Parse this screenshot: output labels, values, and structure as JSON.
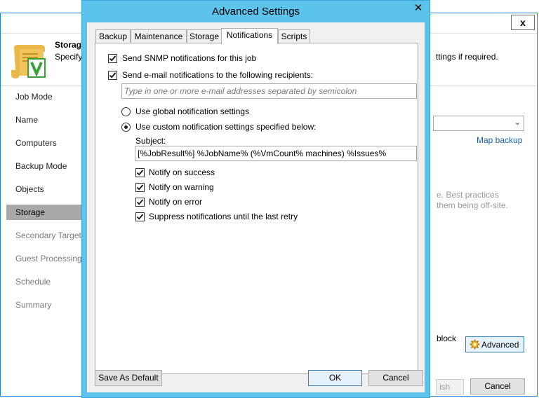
{
  "background_wizard": {
    "close_glyph": "x",
    "header_title": "Storage",
    "header_subtitle": "Specify",
    "header_hint": "ttings if required.",
    "nav_items": [
      {
        "label": "Job Mode",
        "state": "normal"
      },
      {
        "label": "Name",
        "state": "normal"
      },
      {
        "label": "Computers",
        "state": "normal"
      },
      {
        "label": "Backup Mode",
        "state": "normal"
      },
      {
        "label": "Objects",
        "state": "normal"
      },
      {
        "label": "Storage",
        "state": "selected"
      },
      {
        "label": "Secondary Target",
        "state": "dim"
      },
      {
        "label": "Guest Processing",
        "state": "dim"
      },
      {
        "label": "Schedule",
        "state": "dim"
      },
      {
        "label": "Summary",
        "state": "dim"
      }
    ],
    "map_backup_link": "Map backup",
    "hint_line1": "e. Best practices",
    "hint_line2": "them being off-site.",
    "block_text": "block",
    "advanced_button": "Advanced",
    "finish_button": "ish",
    "cancel_button": "Cancel"
  },
  "dialog": {
    "title": "Advanced Settings",
    "close_glyph": "✕",
    "tabs": [
      {
        "label": "Backup",
        "active": false
      },
      {
        "label": "Maintenance",
        "active": false
      },
      {
        "label": "Storage",
        "active": false
      },
      {
        "label": "Notifications",
        "active": true
      },
      {
        "label": "Scripts",
        "active": false
      }
    ],
    "snmp_label": "Send SNMP notifications for this job",
    "snmp_checked": true,
    "email_label": "Send e-mail notifications to the following recipients:",
    "email_checked": true,
    "recipients_placeholder": "Type in one or more e-mail addresses separated by semicolon",
    "recipients_value": "",
    "radio_global_label": "Use global notification settings",
    "radio_global_selected": false,
    "radio_custom_label": "Use custom notification settings specified below:",
    "radio_custom_selected": true,
    "subject_label": "Subject:",
    "subject_value": "[%JobResult%] %JobName% (%VmCount% machines) %Issues%",
    "notify_options": [
      {
        "label": "Notify on success",
        "checked": true
      },
      {
        "label": "Notify on warning",
        "checked": true
      },
      {
        "label": "Notify on error",
        "checked": true
      },
      {
        "label": "Suppress notifications until the last retry",
        "checked": true
      }
    ],
    "save_default_button": "Save As Default",
    "ok_button": "OK",
    "cancel_button": "Cancel"
  },
  "colors": {
    "dialog_frame": "#5cc4ec",
    "selected_nav": "#a9a9a9",
    "link": "#1a5fb4",
    "default_button_border": "#3c7fb1"
  }
}
